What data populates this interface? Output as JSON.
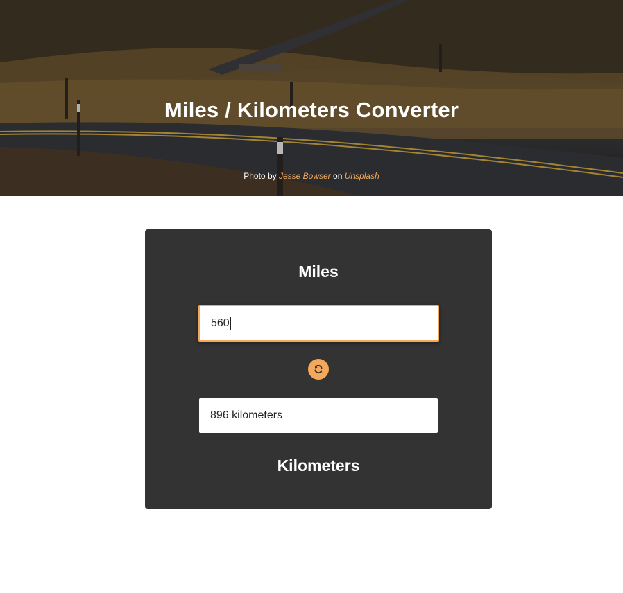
{
  "header": {
    "title": "Miles / Kilometers Converter",
    "credit": {
      "prefix": "Photo by",
      "photographer": "Jesse Bowser",
      "middle": "on",
      "site": "Unsplash"
    }
  },
  "converter": {
    "miles_label": "Miles",
    "miles_value": "560",
    "swap_icon": "refresh-icon",
    "km_value": "896 kilometers",
    "km_label": "Kilometers"
  },
  "colors": {
    "accent": "#f6a85a",
    "card_bg": "#333333"
  }
}
